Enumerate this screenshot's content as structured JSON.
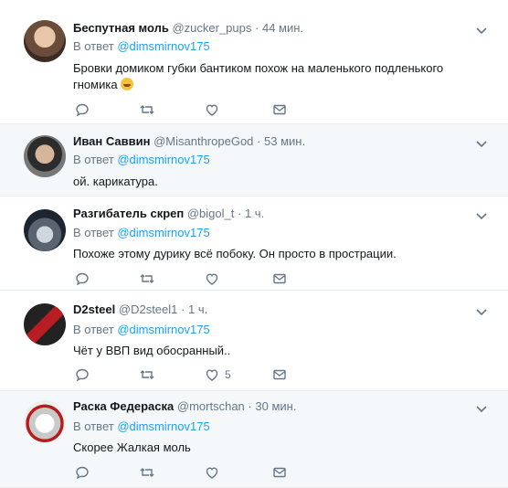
{
  "tweets": [
    {
      "name": "Беспутная моль",
      "handle": "@zucker_pups",
      "time": "44 мин.",
      "reply_prefix": "В ответ",
      "reply_to": "@dimsmirnov175",
      "text": "Бровки домиком губки бантиком похож на маленького подленького гномика",
      "emoji": "laughing-crying-emoji",
      "likes": ""
    },
    {
      "name": "Иван Саввин",
      "handle": "@MisanthropeGod",
      "time": "53 мин.",
      "reply_prefix": "В ответ",
      "reply_to": "@dimsmirnov175",
      "text": "ой. карикатура.",
      "likes": ""
    },
    {
      "name": "Разгибатель скреп",
      "handle": "@bigol_t",
      "time": "1 ч.",
      "reply_prefix": "В ответ",
      "reply_to": "@dimsmirnov175",
      "text": "Похоже этому дурику всё побоку. Он просто в прострации.",
      "likes": ""
    },
    {
      "name": "D2steel",
      "handle": "@D2steel1",
      "time": "1 ч.",
      "reply_prefix": "В ответ",
      "reply_to": "@dimsmirnov175",
      "text": "Чёт у ВВП вид обосранный..",
      "likes": "5"
    },
    {
      "name": "Раска Федераска",
      "handle": "@mortschan",
      "time": "30 мин.",
      "reply_prefix": "В ответ",
      "reply_to": "@dimsmirnov175",
      "text": "Скорее Жалкая моль",
      "likes": ""
    }
  ],
  "separator": "·",
  "colors": {
    "accent": "#1da1f2",
    "secondary": "#657786",
    "gray_bg": "#f5f8fa",
    "white_bg": "#ffffff"
  },
  "icons": [
    "reply-icon",
    "retweet-icon",
    "like-icon",
    "direct-message-icon",
    "chevron-down-icon"
  ]
}
